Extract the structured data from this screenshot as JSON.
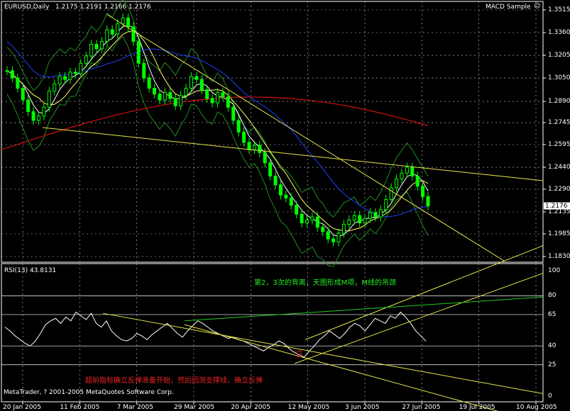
{
  "chart_data": [
    {
      "type": "candlestick",
      "header": {
        "symbol": "EURUSD,Daily",
        "ohlc_text": "1.2175 1.2191 1.2166 1.2176",
        "expert_label": "MACD Sample"
      },
      "y_ticks": [
        "1.3515",
        "1.3360",
        "1.3205",
        "1.3050",
        "1.2890",
        "1.2745",
        "1.2595",
        "1.2440",
        "1.2290",
        "1.2135",
        "1.1985",
        "1.1830"
      ],
      "ylim": [
        1.183,
        1.3515
      ],
      "last_price_tag": "1.2176",
      "x_ticks": [
        "20 Jan 2005",
        "11 Feb 2005",
        "7 Mar 2005",
        "29 Mar 2005",
        "20 Apr 2005",
        "12 May 2005",
        "3 Jun 2005",
        "27 Jun 2005",
        "19 Jul 2005",
        "10 Aug 2005"
      ],
      "close_series_estimated": [
        1.31,
        1.305,
        1.298,
        1.29,
        1.282,
        1.276,
        1.279,
        1.285,
        1.296,
        1.301,
        1.306,
        1.304,
        1.309,
        1.308,
        1.315,
        1.32,
        1.328,
        1.325,
        1.33,
        1.338,
        1.335,
        1.342,
        1.346,
        1.34,
        1.33,
        1.315,
        1.305,
        1.298,
        1.294,
        1.29,
        1.295,
        1.291,
        1.286,
        1.293,
        1.298,
        1.306,
        1.304,
        1.297,
        1.291,
        1.288,
        1.295,
        1.292,
        1.285,
        1.276,
        1.268,
        1.261,
        1.256,
        1.259,
        1.254,
        1.247,
        1.238,
        1.232,
        1.225,
        1.223,
        1.218,
        1.212,
        1.206,
        1.208,
        1.21,
        1.203,
        1.2,
        1.195,
        1.193,
        1.199,
        1.205,
        1.208,
        1.211,
        1.206,
        1.209,
        1.213,
        1.21,
        1.215,
        1.222,
        1.23,
        1.236,
        1.24,
        1.244,
        1.238,
        1.231,
        1.224,
        1.2176
      ],
      "colors": {
        "up": "#00ff00",
        "down": "#00ff00",
        "bollinger": "#1f8f1f",
        "ma_fast": "#ffffff",
        "ma_mid": "#ffff66",
        "ma_blue": "#1e3fff",
        "ma_red": "#d01010",
        "trend": "#e6e64a"
      }
    },
    {
      "type": "line",
      "indicator_label": "RSI(13) 43.8131",
      "levels": [
        "100",
        "80",
        "65",
        "40",
        "25",
        "0"
      ],
      "ylim": [
        0,
        100
      ],
      "rsi_estimated": [
        55,
        52,
        48,
        45,
        42,
        40,
        44,
        50,
        57,
        60,
        62,
        58,
        63,
        60,
        67,
        64,
        61,
        66,
        58,
        55,
        60,
        52,
        48,
        45,
        44,
        46,
        50,
        48,
        45,
        49,
        52,
        55,
        58,
        54,
        50,
        47,
        52,
        56,
        60,
        58,
        55,
        52,
        50,
        48,
        46,
        47,
        45,
        44,
        42,
        40,
        38,
        36,
        39,
        41,
        44,
        42,
        38,
        35,
        33,
        31,
        36,
        40,
        45,
        48,
        52,
        49,
        46,
        50,
        55,
        58,
        56,
        52,
        57,
        62,
        60,
        58,
        64,
        62,
        67,
        63,
        58,
        52,
        48,
        43.8131
      ]
    }
  ],
  "annotations": {
    "top": "第2，3次的背离，天图形成M项，M线的吊颈",
    "bottom": "超前指标确立反弹准备开始，然后回测支撑线，确立反弹"
  },
  "copyright": "MetaTrader, ? 2001-2005 MetaQuotes Software Corp."
}
